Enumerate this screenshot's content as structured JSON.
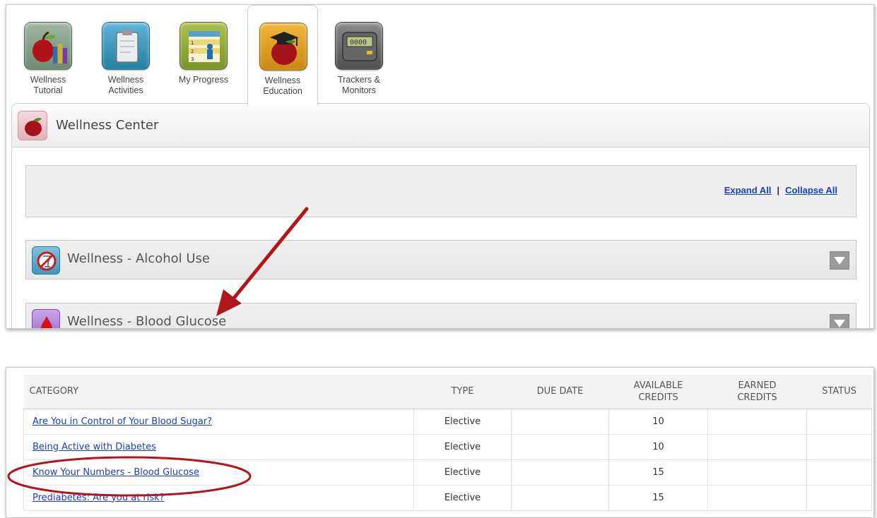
{
  "nav_tabs": [
    {
      "label": "Wellness\nTutorial",
      "icon": "apple-books-icon",
      "active": false
    },
    {
      "label": "Wellness\nActivities",
      "icon": "clipboard-icon",
      "active": false
    },
    {
      "label": "My Progress",
      "icon": "progress-chart-icon",
      "active": false
    },
    {
      "label": "Wellness\nEducation",
      "icon": "apple-graduation-cap-icon",
      "active": true
    },
    {
      "label": "Trackers &\nMonitors",
      "icon": "pedometer-icon",
      "active": false
    }
  ],
  "wellness_center": {
    "title": "Wellness Center",
    "icon": "apple-icon",
    "expand_all": "Expand All",
    "separator": "|",
    "collapse_all": "Collapse All"
  },
  "sections": [
    {
      "title": "Wellness - Alcohol Use",
      "icon": "no-alcohol-icon"
    },
    {
      "title": "Wellness - Blood Glucose",
      "icon": "blood-drop-icon"
    }
  ],
  "table": {
    "headers": [
      "CATEGORY",
      "TYPE",
      "DUE DATE",
      "AVAILABLE\nCREDITS",
      "EARNED\nCREDITS",
      "STATUS"
    ],
    "rows": [
      {
        "category": "Are You in Control of Your Blood Sugar?",
        "type": "Elective",
        "due_date": "",
        "available": "10",
        "earned": "",
        "status": ""
      },
      {
        "category": "Being Active with Diabetes",
        "type": "Elective",
        "due_date": "",
        "available": "10",
        "earned": "",
        "status": ""
      },
      {
        "category": "Know Your Numbers - Blood Glucose",
        "type": "Elective",
        "due_date": "",
        "available": "15",
        "earned": "",
        "status": ""
      },
      {
        "category": "Prediabetes: Are you at risk?",
        "type": "Elective",
        "due_date": "",
        "available": "15",
        "earned": "",
        "status": ""
      }
    ]
  },
  "colors": {
    "link": "#1a3ebf",
    "annotation_red": "#b0171c"
  }
}
